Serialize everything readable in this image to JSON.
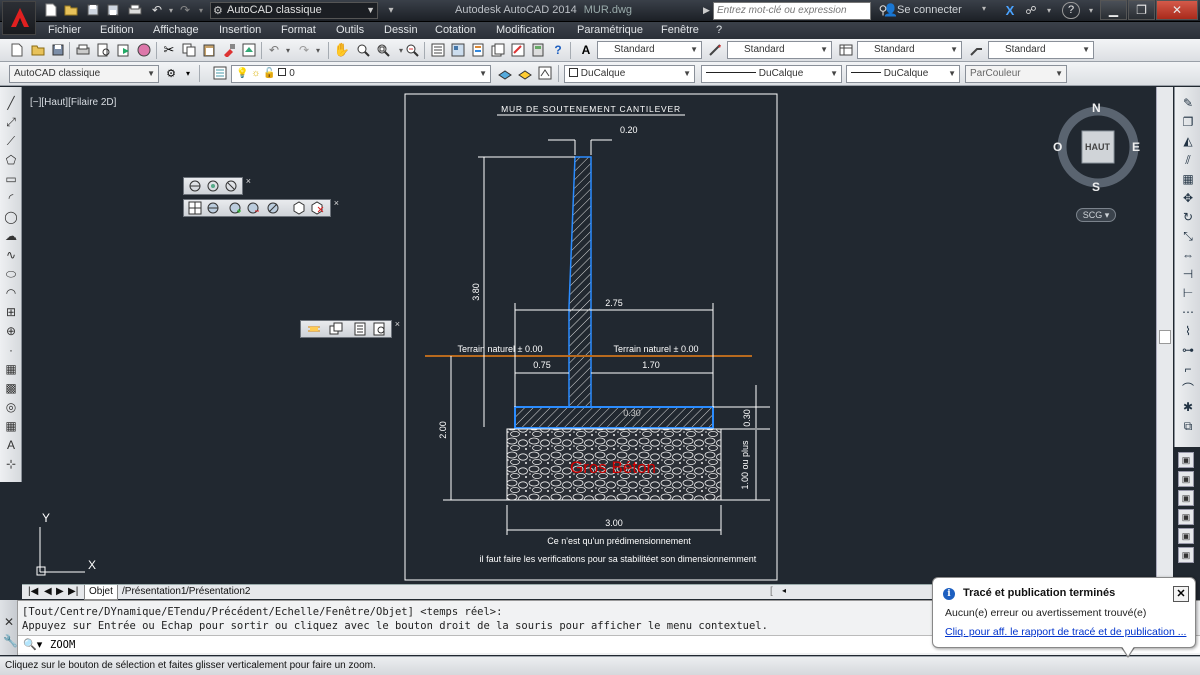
{
  "title_bar": {
    "workspace": "AutoCAD classique",
    "app_title": "Autodesk AutoCAD 2014",
    "file_name": "MUR.dwg",
    "search_placeholder": "Entrez mot-clé ou expression",
    "connect_label": "Se connecter"
  },
  "menu": [
    "Fichier",
    "Edition",
    "Affichage",
    "Insertion",
    "Format",
    "Outils",
    "Dessin",
    "Cotation",
    "Modification",
    "Paramétrique",
    "Fenêtre",
    "?"
  ],
  "toolbar1": {
    "styles": [
      "Standard",
      "Standard",
      "Standard",
      "Standard"
    ]
  },
  "toolbar2": {
    "workspace": "AutoCAD classique",
    "layer": "0",
    "color": "DuCalque",
    "linetype": "DuCalque",
    "lineweight": "DuCalque",
    "plotstyle": "ParCouleur"
  },
  "viewport_label": "[−][Haut][Filaire 2D]",
  "viewcube": {
    "north": "N",
    "south": "S",
    "east": "E",
    "west": "O",
    "face": "HAUT",
    "ucs": "SCG"
  },
  "drawing": {
    "title": "MUR DE SOUTENEMENT CANTILEVER",
    "dim_top": "0.20",
    "dim_height_wall": "3.80",
    "dim_base_width": "2.75",
    "terrain_left": "Terrain naturel ± 0.00",
    "terrain_right": "Terrain naturel ± 0.00",
    "dim_toe": "0.75",
    "dim_heel": "1.70",
    "dim_slab": "0.30",
    "dim_slab_v": "0.30",
    "dim_depth": "2.00",
    "dim_gros_beton": "1.00 ou plus",
    "gros_beton_label": "Gros Béton",
    "dim_width_3": "3.00",
    "note1": "Ce n'est qu'un prédimensionnement",
    "note2": "il faut faire les verifications pour sa stabilitéet son dimensionnemment"
  },
  "ucs_icon": {
    "x_label": "X",
    "y_label": "Y"
  },
  "tabs": [
    "Objet",
    "Présentation1",
    "Présentation2"
  ],
  "command": {
    "line1": "[Tout/Centre/DYnamique/ETendu/Précédent/Echelle/Fenêtre/Objet] <temps réel>:",
    "line2": "Appuyez sur Entrée ou Echap pour sortir ou cliquez avec le bouton droit de la souris pour afficher le menu contextuel.",
    "input": "ZOOM"
  },
  "status_text": "Cliquez sur le bouton de sélection et faites glisser verticalement pour faire un zoom.",
  "notification": {
    "title": "Tracé et publication terminés",
    "body": "Aucun(e) erreur ou avertissement trouvé(e)",
    "link": "Cliq. pour aff. le rapport de tracé et de publication ..."
  },
  "colors": {
    "accent_red": "#d20000",
    "blue_outline": "#2a8cff",
    "terrain": "#b86a1e",
    "canvas": "#212830"
  }
}
